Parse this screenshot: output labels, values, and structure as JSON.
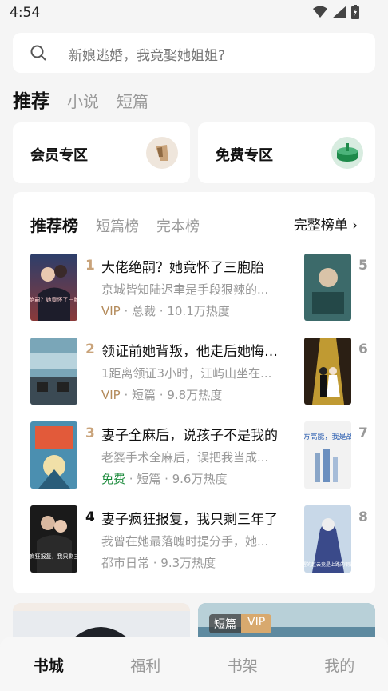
{
  "status": {
    "time": "4:54"
  },
  "search": {
    "placeholder": "新娘逃婚，我竟娶她姐姐?"
  },
  "top_tabs": [
    {
      "label": "推荐",
      "active": true
    },
    {
      "label": "小说",
      "active": false
    },
    {
      "label": "短篇",
      "active": false
    }
  ],
  "zones": [
    {
      "label": "会员专区",
      "icon": "member-icon"
    },
    {
      "label": "免费专区",
      "icon": "free-icon"
    }
  ],
  "ranking": {
    "tabs": [
      {
        "label": "推荐榜",
        "active": true
      },
      {
        "label": "短篇榜",
        "active": false
      },
      {
        "label": "完本榜",
        "active": false
      }
    ],
    "full_label": "完整榜单 ›",
    "items": [
      {
        "num": "1",
        "title": "大佬绝嗣？她竟怀了三胞胎",
        "desc": "京城皆知陆迟聿是手段狠辣的...",
        "badge": "VIP",
        "meta": " · 总裁 · 10.1万热度",
        "cover_text": "大佬绝嗣？她竟怀了三胞胎！"
      },
      {
        "num": "2",
        "title": "领证前她背叛，他走后她悔疯了",
        "desc": "1距离领证3小时，江屿山坐在...",
        "badge": "VIP",
        "meta": " · 短篇 · 9.8万热度",
        "cover_text": ""
      },
      {
        "num": "3",
        "title": "妻子全麻后，说孩子不是我的",
        "desc": "老婆手术全麻后，误把我当成...",
        "badge": "免费",
        "meta": " · 短篇 · 9.6万热度",
        "cover_text": ""
      },
      {
        "num": "4",
        "title": "妻子疯狂报复，我只剩三年了",
        "desc": "我曾在她最落魄时提分手，她...",
        "badge": "",
        "meta": "都市日常 · 9.3万热度",
        "cover_text": "妻子疯狂报复，我只剩三年？"
      }
    ],
    "side_items": [
      {
        "num": "5"
      },
      {
        "num": "6"
      },
      {
        "num": "7",
        "cover_text": "前方高能，我是战马"
      },
      {
        "num": "8",
        "cover_text": "觉醒的赵云竟是上路的钢铁？"
      }
    ]
  },
  "bottom_tag": {
    "a": "短篇",
    "b": "VIP"
  },
  "bottom_nav": [
    {
      "label": "书城",
      "active": true
    },
    {
      "label": "福利",
      "active": false
    },
    {
      "label": "书架",
      "active": false
    },
    {
      "label": "我的",
      "active": false
    }
  ],
  "colors": {
    "accent_gold": "#c9a37a",
    "vip": "#b38a5a",
    "free": "#1a8a3a"
  }
}
